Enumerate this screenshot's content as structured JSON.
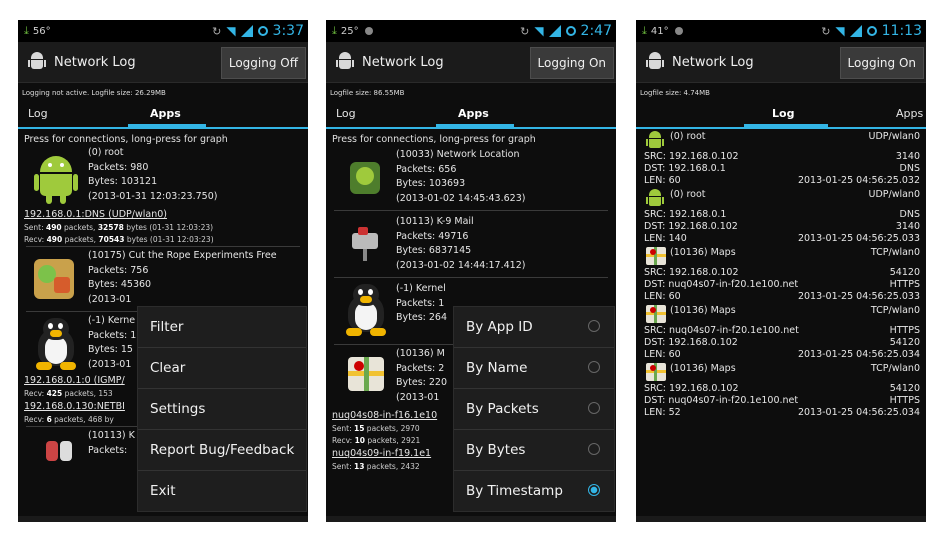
{
  "colors": {
    "accent": "#33b5e5",
    "android_green": "#9fca3c",
    "background": "#0d0d0d",
    "actionbar": "#1b1b1b"
  },
  "icons": {
    "app": "android-robot-icon",
    "download": "download-arrow-icon",
    "wifi": "wifi-icon",
    "signal": "signal-icon",
    "sync": "sync-icon",
    "battery": "battery-ring-icon"
  },
  "screen1": {
    "status": {
      "temp": "56°",
      "time": "3:37"
    },
    "app_title": "Network Log",
    "logging_button": "Logging Off",
    "info": "Logging not active. Logfile size: 26.29MB",
    "tabs": {
      "log": "Log",
      "apps": "Apps"
    },
    "hint": "Press for connections, long-press for graph",
    "entries": [
      {
        "lines": [
          "(0) root",
          "Packets: 980",
          "Bytes: 103121",
          "(2013-01-31 12:03:23.750)"
        ]
      },
      {
        "lines": [
          "(10175) Cut the Rope Experiments Free",
          "Packets: 756",
          "Bytes: 45360",
          "(2013-01"
        ]
      },
      {
        "lines": [
          "(-1) Kerne",
          "Packets: 1",
          "Bytes: 15",
          "(2013-01"
        ]
      },
      {
        "lines": [
          "(10113) K",
          "Packets:"
        ]
      }
    ],
    "conn1": {
      "title": "192.168.0.1:DNS (UDP/wlan0)",
      "sent_pre": "Sent: ",
      "sent_packets": "490",
      "sent_mid": " packets, ",
      "sent_bytes": "32578",
      "sent_post": " bytes (01-31 12:03:23)",
      "recv_pre": "Recv: ",
      "recv_packets": "490",
      "recv_mid": " packets, ",
      "recv_bytes": "70543",
      "recv_post": " bytes (01-31 12:03:23)"
    },
    "conn2": {
      "title": "192.168.0.1:0 (IGMP/",
      "recv_pre": "Recv: ",
      "recv_packets": "425",
      "recv_mid": " packets, 153"
    },
    "conn3": {
      "title": "192.168.0.130:NETBI",
      "recv_pre": "Recv: ",
      "recv_packets": "6",
      "recv_mid": " packets, 468 by"
    },
    "menu": [
      "Filter",
      "Clear",
      "Settings",
      "Report Bug/Feedback",
      "Exit"
    ]
  },
  "screen2": {
    "status": {
      "temp": "25°",
      "time": "2:47"
    },
    "app_title": "Network Log",
    "logging_button": "Logging On",
    "info": "Logfile size: 86.55MB",
    "tabs": {
      "log": "Log",
      "apps": "Apps"
    },
    "hint": "Press for connections, long-press for graph",
    "entries": [
      {
        "lines": [
          "(10033) Network Location",
          "Packets: 656",
          "Bytes: 103693",
          "(2013-01-02 14:45:43.623)"
        ]
      },
      {
        "lines": [
          "(10113) K-9 Mail",
          "Packets: 49716",
          "Bytes: 6837145",
          "(2013-01-02 14:44:17.412)"
        ]
      },
      {
        "lines": [
          "(-1) Kernel",
          "Packets: 1",
          "Bytes: 264"
        ]
      },
      {
        "lines": [
          "(10136) M",
          "Packets: 2",
          "Bytes: 220",
          "(2013-01"
        ]
      }
    ],
    "conn1": {
      "title": "nuq04s08-in-f16.1e10",
      "sent_pre": "Sent: ",
      "sent_packets": "15",
      "sent_mid": " packets, 2970",
      "recv_pre": "Recv: ",
      "recv_packets": "10",
      "recv_mid": " packets, 2921"
    },
    "conn2": {
      "title": "nuq04s09-in-f19.1e1",
      "sent_pre": "Sent: ",
      "sent_packets": "13",
      "sent_mid": " packets, 2432"
    },
    "menu": [
      {
        "label": "By App ID",
        "checked": false
      },
      {
        "label": "By Name",
        "checked": false
      },
      {
        "label": "By Packets",
        "checked": false
      },
      {
        "label": "By Bytes",
        "checked": false
      },
      {
        "label": "By Timestamp",
        "checked": true
      }
    ]
  },
  "screen3": {
    "status": {
      "temp": "41°",
      "time": "11:13"
    },
    "app_title": "Network Log",
    "logging_button": "Logging On",
    "info": "Logfile size: 4.74MB",
    "tabs": {
      "log": "Log",
      "apps": "Apps"
    },
    "records": [
      {
        "icon": "android",
        "name": "(0) root",
        "proto": "UDP/wlan0",
        "src": "SRC: 192.168.0.102",
        "src_port": "3140",
        "dst": "DST: 192.168.0.1",
        "dst_port": "DNS",
        "len": "LEN: 60",
        "time": "2013-01-25 04:56:25.032"
      },
      {
        "icon": "android",
        "name": "(0) root",
        "proto": "UDP/wlan0",
        "src": "SRC: 192.168.0.1",
        "src_port": "DNS",
        "dst": "DST: 192.168.0.102",
        "dst_port": "3140",
        "len": "LEN: 140",
        "time": "2013-01-25 04:56:25.033"
      },
      {
        "icon": "maps",
        "name": "(10136) Maps",
        "proto": "TCP/wlan0",
        "src": "SRC: 192.168.0.102",
        "src_port": "54120",
        "dst": "DST: nuq04s07-in-f20.1e100.net",
        "dst_port": "HTTPS",
        "len": "LEN: 60",
        "time": "2013-01-25 04:56:25.033"
      },
      {
        "icon": "maps",
        "name": "(10136) Maps",
        "proto": "TCP/wlan0",
        "src": "SRC: nuq04s07-in-f20.1e100.net",
        "src_port": "HTTPS",
        "dst": "DST: 192.168.0.102",
        "dst_port": "54120",
        "len": "LEN: 60",
        "time": "2013-01-25 04:56:25.034"
      },
      {
        "icon": "maps",
        "name": "(10136) Maps",
        "proto": "TCP/wlan0",
        "src": "SRC: 192.168.0.102",
        "src_port": "54120",
        "dst": "DST: nuq04s07-in-f20.1e100.net",
        "dst_port": "HTTPS",
        "len": "LEN: 52",
        "time": "2013-01-25 04:56:25.034"
      }
    ]
  }
}
